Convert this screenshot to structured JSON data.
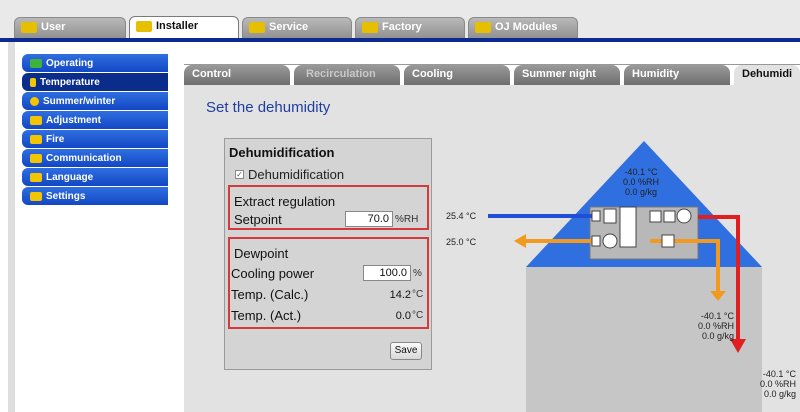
{
  "top_tabs": [
    {
      "label": "User",
      "icon": "users-icon",
      "color": "#f3c400"
    },
    {
      "label": "Installer",
      "icon": "tools-icon",
      "color": "#f3c400"
    },
    {
      "label": "Service",
      "icon": "service-icon",
      "color": "#f3c400"
    },
    {
      "label": "Factory",
      "icon": "factory-icon",
      "color": "#f3c400"
    },
    {
      "label": "OJ Modules",
      "icon": "modules-icon",
      "color": "#f3c400"
    }
  ],
  "sidebar": {
    "items": [
      {
        "label": "Operating",
        "icon": "operating-icon"
      },
      {
        "label": "Temperature",
        "icon": "thermometer-icon"
      },
      {
        "label": "Summer/winter",
        "icon": "sun-icon"
      },
      {
        "label": "Adjustment",
        "icon": "adjustment-icon"
      },
      {
        "label": "Fire",
        "icon": "fire-icon"
      },
      {
        "label": "Communication",
        "icon": "communication-icon"
      },
      {
        "label": "Language",
        "icon": "language-icon"
      },
      {
        "label": "Settings",
        "icon": "settings-icon"
      }
    ]
  },
  "sub_tabs": [
    "Control",
    "Recirculation",
    "Cooling",
    "Summer night",
    "Humidity",
    "Dehumidi"
  ],
  "page_title": "Set the dehumidity",
  "panel": {
    "title": "Dehumidification",
    "checkbox_label": "Dehumidification",
    "extract_title": "Extract regulation",
    "setpoint_label": "Setpoint",
    "setpoint_value": "70.0",
    "setpoint_unit": "%RH",
    "dewpoint_title": "Dewpoint",
    "cooling_power_label": "Cooling power",
    "cooling_power_value": "100.0",
    "cooling_power_unit": "%",
    "temp_calc_label": "Temp. (Calc.)",
    "temp_calc_value": "14.2",
    "temp_calc_unit": "°C",
    "temp_act_label": "Temp. (Act.)",
    "temp_act_value": "0.0",
    "temp_act_unit": "°C",
    "save_label": "Save"
  },
  "diagram": {
    "roof": {
      "temp": "-40.1 °C",
      "rh": "0.0 %RH",
      "abs": "0.0 g/kg"
    },
    "supply_in": "25.4 °C",
    "extract_out": "25.0 °C",
    "middle": {
      "temp": "-40.1 °C",
      "rh": "0.0 %RH",
      "abs": "0.0 g/kg"
    },
    "bottom": {
      "temp": "-40.1 °C",
      "rh": "0.0 %RH",
      "abs": "0.0 g/kg"
    }
  },
  "colors": {
    "accent": "#1f4fd4",
    "nav_active": "#0a2d8c",
    "highlight_red": "#d43a3a",
    "air_orange": "#f29a20",
    "air_red": "#e02020",
    "roof_blue": "#2f6fe0"
  }
}
